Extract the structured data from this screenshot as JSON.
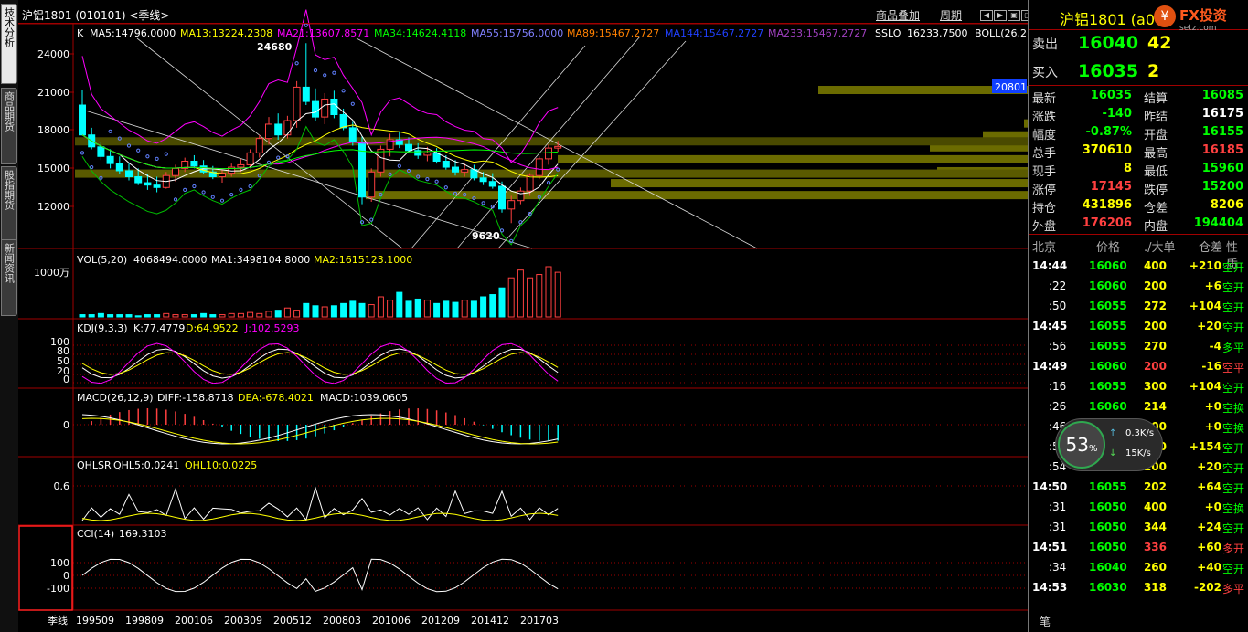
{
  "tabs": [
    "技术分析",
    "商品期货",
    "股指期货",
    "新闻资讯"
  ],
  "window_title": "沪铝1801 (010101) <季线>",
  "toolbar": {
    "overlay_label": "商品叠加",
    "period_label": "周期"
  },
  "main_legend": {
    "k": "K",
    "ma5": "MA5:14796.0000",
    "ma13": "MA13:13224.2308",
    "ma21": "MA21:13607.8571",
    "ma34": "MA34:14624.4118",
    "ma55": "MA55:15756.0000",
    "ma89": "MA89:15467.2727",
    "ma144": "MA144:15467.2727",
    "ma233": "MA233:15467.2727",
    "sslo": "SSLO",
    "sslo_val": "16233.7500",
    "boll": "BOLL(26,2"
  },
  "main_annotations": {
    "high": "24680",
    "low": "9620",
    "price_tag": "20801"
  },
  "main_yaxis": [
    "24000",
    "21000",
    "18000",
    "15000",
    "12000"
  ],
  "vol_legend": {
    "name": "VOL(5,20)",
    "vol": "4068494.0000",
    "ma1": "MA1:3498104.8000",
    "ma2": "MA2:1615123.1000",
    "unit": "1000万"
  },
  "kdj_legend": {
    "name": "KDJ(9,3,3)",
    "k": "K:77.4779",
    "d": "D:64.9522",
    "j": "J:102.5293",
    "ticks": [
      "100",
      "80",
      "50",
      "20",
      "0"
    ]
  },
  "macd_legend": {
    "name": "MACD(26,12,9)",
    "diff": "DIFF:-158.8718",
    "dea": "DEA:-678.4021",
    "macd": "MACD:1039.0605",
    "tick": "0"
  },
  "qhlsr_legend": {
    "name": "QHLSR",
    "qhl5": "QHL5:0.0241",
    "qhl10": "QHL10:0.0225",
    "tick": "0.6"
  },
  "cci_legend": {
    "name": "CCI(14)",
    "val": "169.3103",
    "ticks": [
      "100",
      "0",
      "-100"
    ]
  },
  "xaxis": {
    "period": "季线",
    "labels": [
      "199509",
      "199809",
      "200106",
      "200309",
      "200512",
      "200803",
      "201006",
      "201209",
      "201412",
      "201703"
    ]
  },
  "quote": {
    "title": "沪铝1801 (a",
    "title_tail": "01)",
    "sell_label": "卖出",
    "sell_price": "16040",
    "sell_vol": "42",
    "buy_label": "买入",
    "buy_price": "16035",
    "buy_vol": "2",
    "stats": [
      {
        "l1": "最新",
        "v1": "16035",
        "c1": "#00ff00",
        "l2": "结算",
        "v2": "16085",
        "c2": "#00ff00"
      },
      {
        "l1": "涨跌",
        "v1": "-140",
        "c1": "#00ff00",
        "l2": "昨结",
        "v2": "16175",
        "c2": "#ffffff"
      },
      {
        "l1": "幅度",
        "v1": "-0.87%",
        "c1": "#00ff00",
        "l2": "开盘",
        "v2": "16155",
        "c2": "#00ff00"
      },
      {
        "l1": "总手",
        "v1": "370610",
        "c1": "#ffff00",
        "l2": "最高",
        "v2": "16185",
        "c2": "#ff4040"
      },
      {
        "l1": "现手",
        "v1": "8",
        "c1": "#ffff00",
        "l2": "最低",
        "v2": "15960",
        "c2": "#00ff00"
      },
      {
        "l1": "涨停",
        "v1": "17145",
        "c1": "#ff4040",
        "l2": "跌停",
        "v2": "15200",
        "c2": "#00ff00"
      },
      {
        "l1": "持仓",
        "v1": "431896",
        "c1": "#ffff00",
        "l2": "仓差",
        "v2": "8206",
        "c2": "#ffff00"
      },
      {
        "l1": "外盘",
        "v1": "176206",
        "c1": "#ff4040",
        "l2": "内盘",
        "v2": "194404",
        "c2": "#00ff00"
      }
    ],
    "tick_header": {
      "c1": "北京",
      "c2": "价格",
      "c3": "./大单",
      "c4": "仓差",
      "c5": "性质"
    },
    "ticks": [
      {
        "t": "14:44",
        "p": "16060",
        "v": "400",
        "vc": "#ffff00",
        "d": "+210",
        "n": "空开",
        "nc": "#00ff00",
        "bold": true
      },
      {
        "t": ":22",
        "p": "16060",
        "v": "200",
        "vc": "#ffff00",
        "d": "+6",
        "n": "空开",
        "nc": "#00ff00",
        "bold": false
      },
      {
        "t": ":50",
        "p": "16055",
        "v": "272",
        "vc": "#ffff00",
        "d": "+104",
        "n": "空开",
        "nc": "#00ff00",
        "bold": false
      },
      {
        "t": "14:45",
        "p": "16055",
        "v": "200",
        "vc": "#ffff00",
        "d": "+20",
        "n": "空开",
        "nc": "#00ff00",
        "bold": true
      },
      {
        "t": ":56",
        "p": "16055",
        "v": "270",
        "vc": "#ffff00",
        "d": "-4",
        "n": "多平",
        "nc": "#00ff00",
        "bold": false
      },
      {
        "t": "14:49",
        "p": "16060",
        "v": "200",
        "vc": "#ff4040",
        "d": "-16",
        "n": "空平",
        "nc": "#ff4040",
        "bold": true
      },
      {
        "t": ":16",
        "p": "16055",
        "v": "300",
        "vc": "#ffff00",
        "d": "+104",
        "n": "空开",
        "nc": "#00ff00",
        "bold": false
      },
      {
        "t": ":26",
        "p": "16060",
        "v": "214",
        "vc": "#ffff00",
        "d": "+0",
        "n": "空换",
        "nc": "#00ff00",
        "bold": false
      },
      {
        "t": ":46",
        "p": "16060",
        "v": "200",
        "vc": "#ffff00",
        "d": "+0",
        "n": "空换",
        "nc": "#00ff00",
        "bold": false
      },
      {
        "t": ":51",
        "p": "16055",
        "v": "200",
        "vc": "#ffff00",
        "d": "+154",
        "n": "空开",
        "nc": "#00ff00",
        "bold": false
      },
      {
        "t": ":54",
        "p": "16055",
        "v": "200",
        "vc": "#ffff00",
        "d": "+20",
        "n": "空开",
        "nc": "#00ff00",
        "bold": false
      },
      {
        "t": "14:50",
        "p": "16055",
        "v": "202",
        "vc": "#ffff00",
        "d": "+64",
        "n": "空开",
        "nc": "#00ff00",
        "bold": true
      },
      {
        "t": ":31",
        "p": "16050",
        "v": "400",
        "vc": "#ffff00",
        "d": "+0",
        "n": "空换",
        "nc": "#00ff00",
        "bold": false
      },
      {
        "t": ":31",
        "p": "16050",
        "v": "344",
        "vc": "#ffff00",
        "d": "+24",
        "n": "空开",
        "nc": "#00ff00",
        "bold": false
      },
      {
        "t": "14:51",
        "p": "16050",
        "v": "336",
        "vc": "#ff4040",
        "d": "+60",
        "n": "多开",
        "nc": "#ff4040",
        "bold": true
      },
      {
        "t": ":34",
        "p": "16040",
        "v": "260",
        "vc": "#ffff00",
        "d": "+40",
        "n": "空开",
        "nc": "#00ff00",
        "bold": false
      },
      {
        "t": "14:53",
        "p": "16030",
        "v": "318",
        "vc": "#ffff00",
        "d": "-202",
        "n": "多平",
        "nc": "#ff4040",
        "bold": true
      }
    ],
    "bottom_label": "笔"
  },
  "gauge": {
    "percent": "53",
    "pct_sign": "%",
    "up": "0.3K/s",
    "down": "15K/s"
  },
  "logo": {
    "text": "FX投资",
    "sub": "setz.com"
  },
  "colors": {
    "accent": "#a00000",
    "up": "#ff4040",
    "down": "#00ffff",
    "yellow": "#ffff00"
  },
  "chart_data": {
    "type": "candlestick",
    "period": "季线",
    "yrange": [
      7500,
      26000
    ],
    "candles": [
      [
        19500,
        20800,
        17000,
        17000
      ],
      [
        17000,
        17600,
        15800,
        16000
      ],
      [
        16000,
        16400,
        14900,
        15200
      ],
      [
        15200,
        15800,
        14200,
        14600
      ],
      [
        14600,
        15200,
        13700,
        14000
      ],
      [
        14000,
        14600,
        13200,
        13500
      ],
      [
        13500,
        14200,
        12800,
        13000
      ],
      [
        13000,
        13700,
        12400,
        12800
      ],
      [
        12800,
        13500,
        12200,
        12600
      ],
      [
        12600,
        13900,
        12500,
        13600
      ],
      [
        13600,
        14500,
        13100,
        14200
      ],
      [
        14200,
        15100,
        13900,
        14800
      ],
      [
        14800,
        15300,
        14200,
        14400
      ],
      [
        14400,
        14900,
        13700,
        13900
      ],
      [
        13900,
        14400,
        13300,
        13500
      ],
      [
        13500,
        14100,
        13000,
        13800
      ],
      [
        13800,
        14600,
        13500,
        14300
      ],
      [
        14300,
        15000,
        13900,
        14500
      ],
      [
        14500,
        15800,
        14200,
        15500
      ],
      [
        15500,
        17000,
        15100,
        16700
      ],
      [
        16700,
        18500,
        16200,
        17900
      ],
      [
        17900,
        18800,
        16600,
        17000
      ],
      [
        17000,
        18600,
        16700,
        18200
      ],
      [
        18200,
        21500,
        17600,
        21000
      ],
      [
        21000,
        24680,
        19500,
        19800
      ],
      [
        19800,
        20900,
        18200,
        18500
      ],
      [
        18500,
        20500,
        17900,
        20000
      ],
      [
        20000,
        20700,
        18400,
        18700
      ],
      [
        18700,
        19200,
        17400,
        17600
      ],
      [
        17600,
        18100,
        16100,
        16400
      ],
      [
        16400,
        16900,
        11200,
        11800
      ],
      [
        11800,
        14200,
        11400,
        13900
      ],
      [
        13900,
        16100,
        13500,
        15800
      ],
      [
        15800,
        17100,
        15200,
        16600
      ],
      [
        16600,
        17300,
        15900,
        16200
      ],
      [
        16200,
        16800,
        15500,
        15700
      ],
      [
        15700,
        16300,
        15000,
        15300
      ],
      [
        15300,
        16000,
        14800,
        15500
      ],
      [
        15500,
        15900,
        14600,
        14800
      ],
      [
        14800,
        15300,
        14100,
        14300
      ],
      [
        14300,
        14900,
        13600,
        13900
      ],
      [
        13900,
        14600,
        13500,
        14100
      ],
      [
        14100,
        14500,
        13200,
        13400
      ],
      [
        13400,
        13900,
        12800,
        13100
      ],
      [
        13100,
        13800,
        12500,
        12700
      ],
      [
        12700,
        13100,
        10500,
        10800
      ],
      [
        10800,
        11900,
        9620,
        11500
      ],
      [
        11500,
        12600,
        11200,
        12300
      ],
      [
        12300,
        13800,
        11900,
        13600
      ],
      [
        13600,
        15200,
        13300,
        15000
      ],
      [
        15000,
        16200,
        14500,
        15900
      ],
      [
        15900,
        16500,
        15600,
        16035
      ]
    ],
    "ma_series": [
      {
        "name": "MA5",
        "color": "#ffffff"
      },
      {
        "name": "MA13",
        "color": "#ffff00"
      },
      {
        "name": "MA21",
        "color": "#ff00ff"
      },
      {
        "name": "MA34",
        "color": "#00ff00"
      }
    ],
    "volume": [
      2,
      2,
      3,
      2,
      2,
      2,
      1,
      2,
      2,
      3,
      2,
      2,
      2,
      3,
      2,
      2,
      3,
      3,
      4,
      3,
      5,
      6,
      8,
      6,
      12,
      10,
      9,
      10,
      12,
      14,
      12,
      11,
      18,
      15,
      22,
      14,
      16,
      15,
      12,
      14,
      13,
      15,
      14,
      18,
      20,
      26,
      35,
      42,
      35,
      38,
      45,
      40
    ],
    "price_zones": [
      20801,
      18000,
      17000,
      16000,
      15000,
      14000,
      13000,
      12000
    ]
  }
}
